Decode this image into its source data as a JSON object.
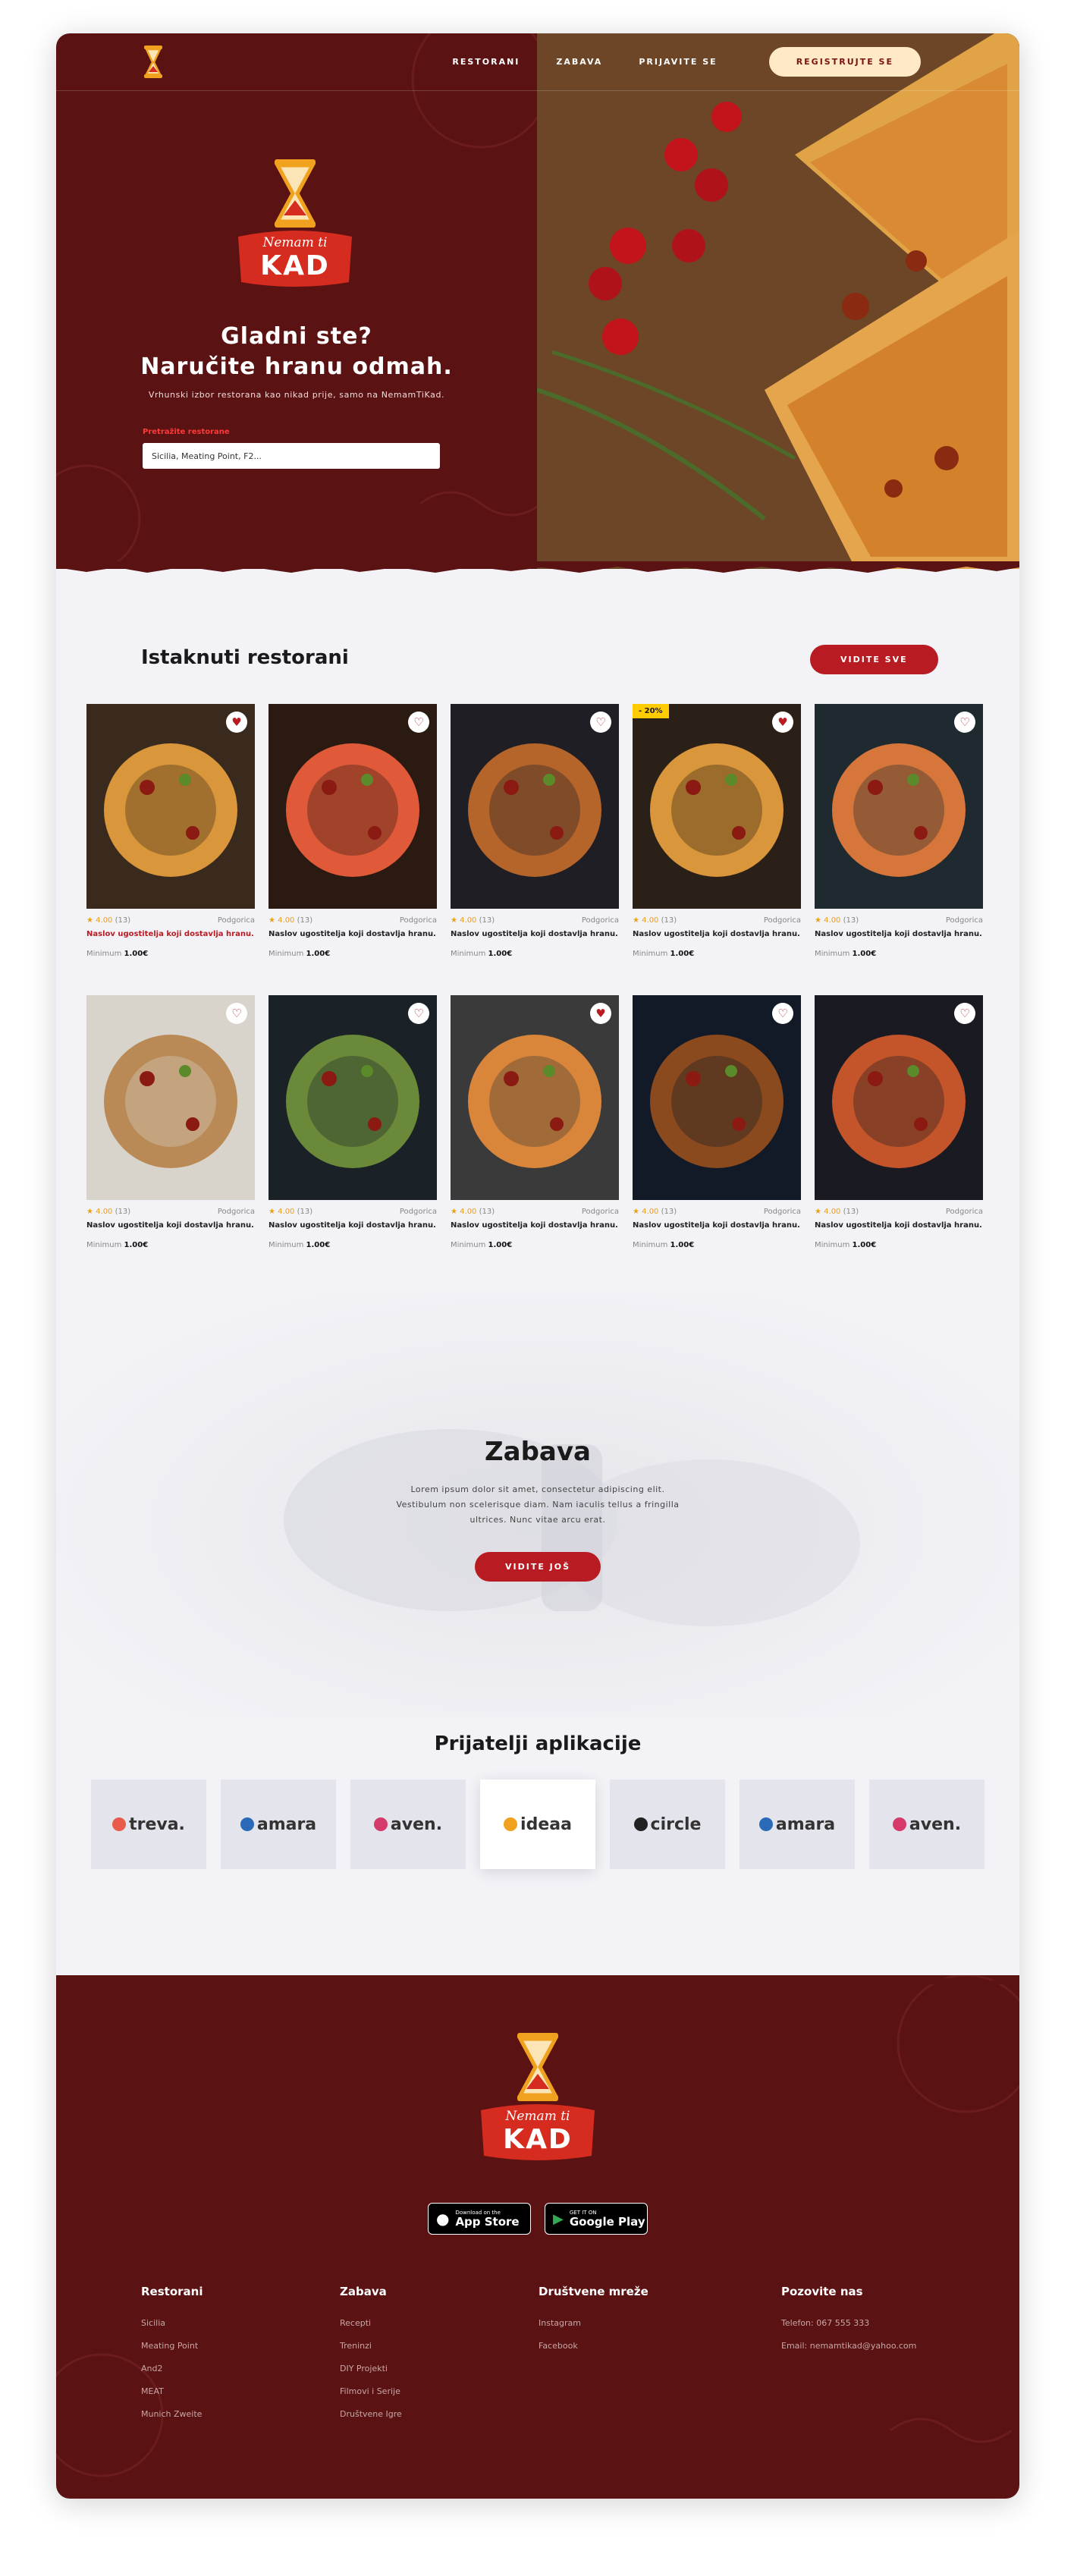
{
  "nav": {
    "links": [
      "RESTORANI",
      "ZABAVA",
      "PRIJAVITE SE"
    ],
    "register": "REGISTRUJTE SE"
  },
  "logo": {
    "line1": "Nemam ti",
    "line2": "KAD"
  },
  "hero": {
    "title_line1": "Gladni ste?",
    "title_line2": "Naručite hranu odmah.",
    "subtitle": "Vrhunski izbor restorana kao nikad prije, samo na NemamTiKad.",
    "search_label": "Pretražite restorane",
    "search_value": "Sicilia, Meating Point, F2..."
  },
  "featured": {
    "title": "Istaknuti restorani",
    "see_all": "VIDITE SVE",
    "cards": [
      {
        "rating": "4.00",
        "count": "(13)",
        "city": "Podgorica",
        "name": "Naslov ugostitelja koji dostavlja hranu.",
        "min_label": "Minimum",
        "min": "1.00€",
        "discount": ""
      },
      {
        "rating": "4.00",
        "count": "(13)",
        "city": "Podgorica",
        "name": "Naslov ugostitelja koji dostavlja hranu.",
        "min_label": "Minimum",
        "min": "1.00€",
        "discount": ""
      },
      {
        "rating": "4.00",
        "count": "(13)",
        "city": "Podgorica",
        "name": "Naslov ugostitelja koji dostavlja hranu.",
        "min_label": "Minimum",
        "min": "1.00€",
        "discount": ""
      },
      {
        "rating": "4.00",
        "count": "(13)",
        "city": "Podgorica",
        "name": "Naslov ugostitelja koji dostavlja hranu.",
        "min_label": "Minimum",
        "min": "1.00€",
        "discount": "- 20%"
      },
      {
        "rating": "4.00",
        "count": "(13)",
        "city": "Podgorica",
        "name": "Naslov ugostitelja koji dostavlja hranu.",
        "min_label": "Minimum",
        "min": "1.00€",
        "discount": ""
      },
      {
        "rating": "4.00",
        "count": "(13)",
        "city": "Podgorica",
        "name": "Naslov ugostitelja koji dostavlja hranu.",
        "min_label": "Minimum",
        "min": "1.00€",
        "discount": ""
      },
      {
        "rating": "4.00",
        "count": "(13)",
        "city": "Podgorica",
        "name": "Naslov ugostitelja koji dostavlja hranu.",
        "min_label": "Minimum",
        "min": "1.00€",
        "discount": ""
      },
      {
        "rating": "4.00",
        "count": "(13)",
        "city": "Podgorica",
        "name": "Naslov ugostitelja koji dostavlja hranu.",
        "min_label": "Minimum",
        "min": "1.00€",
        "discount": ""
      },
      {
        "rating": "4.00",
        "count": "(13)",
        "city": "Podgorica",
        "name": "Naslov ugostitelja koji dostavlja hranu.",
        "min_label": "Minimum",
        "min": "1.00€",
        "discount": ""
      },
      {
        "rating": "4.00",
        "count": "(13)",
        "city": "Podgorica",
        "name": "Naslov ugostitelja koji dostavlja hranu.",
        "min_label": "Minimum",
        "min": "1.00€",
        "discount": ""
      }
    ]
  },
  "fun": {
    "title": "Zabava",
    "text": "Lorem ipsum dolor sit amet, consectetur adipiscing elit. Vestibulum non scelerisque diam. Nam iaculis tellus a fringilla ultrices. Nunc vitae arcu erat.",
    "button": "VIDITE JOŠ"
  },
  "partners": {
    "title": "Prijatelji aplikacije",
    "items": [
      "treva.",
      "amara",
      "aven.",
      "ideaa",
      "circle",
      "amara",
      "aven."
    ]
  },
  "footer": {
    "appstore_small": "Download on the",
    "appstore_big": "App Store",
    "play_small": "GET IT ON",
    "play_big": "Google Play",
    "columns": [
      {
        "title": "Restorani",
        "links": [
          "Sicilia",
          "Meating Point",
          "And2",
          "MEAT",
          "Munich Zweite"
        ]
      },
      {
        "title": "Zabava",
        "links": [
          "Recepti",
          "Treninzi",
          "DIY Projekti",
          "Filmovi i Serije",
          "Društvene Igre"
        ]
      },
      {
        "title": "Društvene mreže",
        "links": [
          "Instagram",
          "Facebook"
        ]
      },
      {
        "title": "Pozovite nas",
        "links": [
          "Telefon: 067 555 333",
          "Email: nemamtikad@yahoo.com"
        ]
      }
    ]
  },
  "colors": {
    "maroon": "#5a1212",
    "accent_red": "#b81c22",
    "cream": "#ffe9c7",
    "star": "#e8a21a"
  }
}
